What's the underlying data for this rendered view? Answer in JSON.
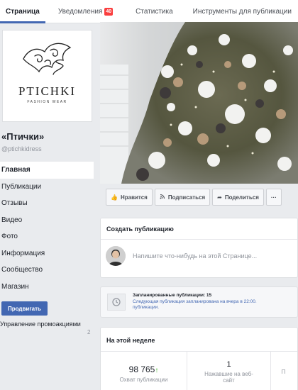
{
  "tabs": [
    {
      "label": "Страница",
      "active": true
    },
    {
      "label": "Уведомления",
      "badge": "40"
    },
    {
      "label": "Статистика"
    },
    {
      "label": "Инструменты для публикации"
    }
  ],
  "brand": {
    "logo_text": "PTICHKI",
    "logo_sub": "FASHION WEAR"
  },
  "page": {
    "name": "«Птички»",
    "handle": "@ptichkidress"
  },
  "nav": [
    {
      "label": "Главная",
      "active": true
    },
    {
      "label": "Публикации"
    },
    {
      "label": "Отзывы"
    },
    {
      "label": "Видео"
    },
    {
      "label": "Фото"
    },
    {
      "label": "Информация"
    },
    {
      "label": "Сообщество"
    },
    {
      "label": "Магазин"
    }
  ],
  "promote_button": "Продвигать",
  "manage_promotions": {
    "label": "Управление промоакциями",
    "count": "2"
  },
  "actions": {
    "like": "Нравится",
    "follow": "Подписаться",
    "share": "Поделиться",
    "more": "···"
  },
  "create_post": {
    "title": "Создать публикацию",
    "placeholder": "Напишите что-нибудь на этой Странице..."
  },
  "scheduled": {
    "title": "Запланированные публикации: 15",
    "line2": "Следующая публикация запланирована на вчера в 22:00.",
    "line3": "публикации."
  },
  "week": {
    "title": "На этой неделе",
    "stats": [
      {
        "value": "98 765",
        "trend": "↑",
        "label": "Охват публикации"
      },
      {
        "value": "1",
        "label": "Нажавшие на веб-сайт"
      },
      {
        "value": "",
        "label": "П"
      }
    ]
  },
  "colors": {
    "accent": "#4267b2",
    "badge": "#fa3e3e",
    "trend_up": "#42b72a",
    "background": "#e9ebee"
  },
  "icons": {
    "like": "thumbs-up-icon",
    "follow": "rss-icon",
    "share": "share-arrow-icon",
    "scheduled": "clock-icon"
  }
}
